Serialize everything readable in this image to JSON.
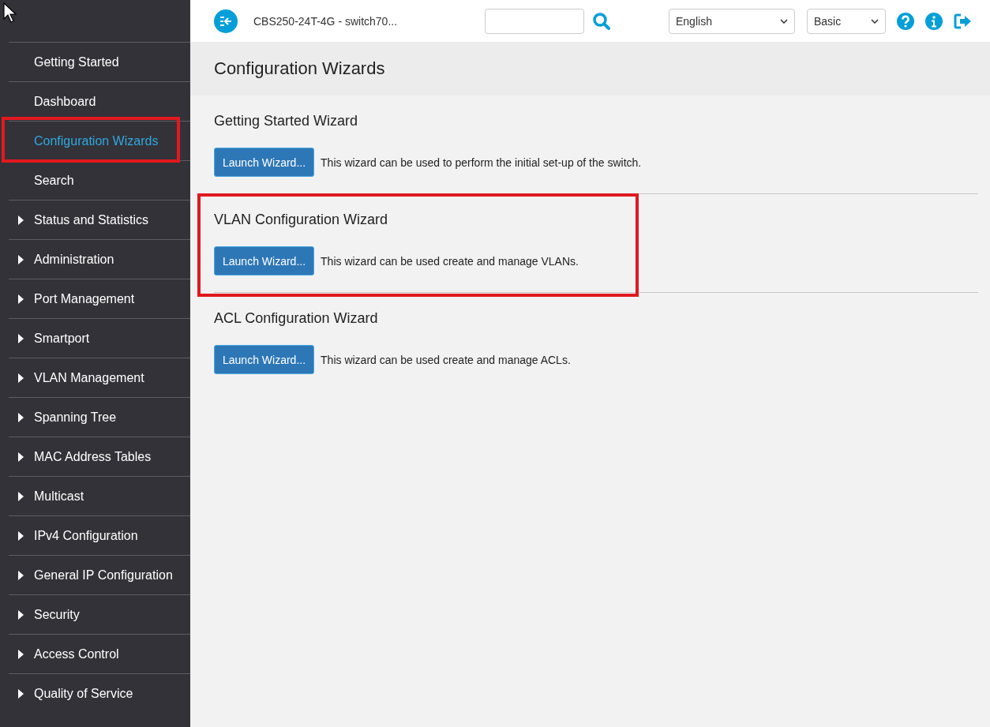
{
  "sidebar": {
    "items": [
      {
        "label": "Getting Started",
        "kind": "link",
        "selected": false,
        "highlighted": false
      },
      {
        "label": "Dashboard",
        "kind": "link",
        "selected": false,
        "highlighted": false
      },
      {
        "label": "Configuration Wizards",
        "kind": "link",
        "selected": true,
        "highlighted": true
      },
      {
        "label": "Search",
        "kind": "link",
        "selected": false,
        "highlighted": false
      },
      {
        "label": "Status and Statistics",
        "kind": "group",
        "selected": false,
        "highlighted": false
      },
      {
        "label": "Administration",
        "kind": "group",
        "selected": false,
        "highlighted": false
      },
      {
        "label": "Port Management",
        "kind": "group",
        "selected": false,
        "highlighted": false
      },
      {
        "label": "Smartport",
        "kind": "group",
        "selected": false,
        "highlighted": false
      },
      {
        "label": "VLAN Management",
        "kind": "group",
        "selected": false,
        "highlighted": false
      },
      {
        "label": "Spanning Tree",
        "kind": "group",
        "selected": false,
        "highlighted": false
      },
      {
        "label": "MAC Address Tables",
        "kind": "group",
        "selected": false,
        "highlighted": false
      },
      {
        "label": "Multicast",
        "kind": "group",
        "selected": false,
        "highlighted": false
      },
      {
        "label": "IPv4 Configuration",
        "kind": "group",
        "selected": false,
        "highlighted": false
      },
      {
        "label": "General IP Configuration",
        "kind": "group",
        "selected": false,
        "highlighted": false
      },
      {
        "label": "Security",
        "kind": "group",
        "selected": false,
        "highlighted": false
      },
      {
        "label": "Access Control",
        "kind": "group",
        "selected": false,
        "highlighted": false
      },
      {
        "label": "Quality of Service",
        "kind": "group",
        "selected": false,
        "highlighted": false
      }
    ]
  },
  "header": {
    "device": "CBS250-24T-4G - switch70...",
    "language": "English",
    "mode": "Basic"
  },
  "page": {
    "title": "Configuration Wizards",
    "wizards": [
      {
        "title": "Getting Started Wizard",
        "button": "Launch Wizard...",
        "description": "This wizard can be used to perform the initial set-up of the switch.",
        "highlighted": false
      },
      {
        "title": "VLAN Configuration Wizard",
        "button": "Launch Wizard...",
        "description": "This wizard can be used create and manage VLANs.",
        "highlighted": true
      },
      {
        "title": "ACL Configuration Wizard",
        "button": "Launch Wizard...",
        "description": "This wizard can be used create and manage ACLs.",
        "highlighted": false
      }
    ]
  }
}
